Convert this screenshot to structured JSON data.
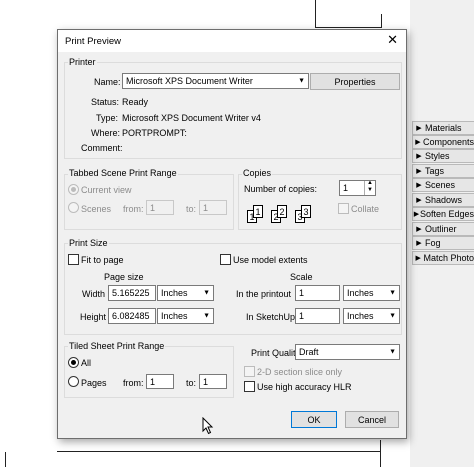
{
  "dialog": {
    "title": "Print Preview",
    "printer": {
      "group_label": "Printer",
      "name_label": "Name:",
      "name_value": "Microsoft XPS Document Writer",
      "properties_label": "Properties",
      "status_label": "Status:",
      "status_value": "Ready",
      "type_label": "Type:",
      "type_value": "Microsoft XPS Document Writer v4",
      "where_label": "Where:",
      "where_value": "PORTPROMPT:",
      "comment_label": "Comment:",
      "comment_value": ""
    },
    "scene_range": {
      "group_label": "Tabbed Scene Print Range",
      "current_view_label": "Current view",
      "scenes_label": "Scenes",
      "from_label": "from:",
      "from_value": "1",
      "to_label": "to:",
      "to_value": "1"
    },
    "copies": {
      "group_label": "Copies",
      "number_label": "Number of copies:",
      "number_value": "1",
      "collate_label": "Collate"
    },
    "print_size": {
      "group_label": "Print Size",
      "fit_to_page_label": "Fit to page",
      "use_model_extents_label": "Use model extents",
      "page_size_label": "Page size",
      "scale_label": "Scale",
      "width_label": "Width",
      "width_value": "5.165225",
      "width_unit": "Inches",
      "height_label": "Height",
      "height_value": "6.082485",
      "height_unit": "Inches",
      "in_printout_label": "In the printout",
      "in_printout_value": "1",
      "in_printout_unit": "Inches",
      "in_sketchup_label": "In SketchUp",
      "in_sketchup_value": "1",
      "in_sketchup_unit": "Inches"
    },
    "sheet_range": {
      "group_label": "Tiled Sheet Print Range",
      "all_label": "All",
      "pages_label": "Pages",
      "from_label": "from:",
      "from_value": "1",
      "to_label": "to:",
      "to_value": "1"
    },
    "quality": {
      "label": "Print Quality",
      "value": "Draft",
      "section_slice_label": "2-D section slice only",
      "high_accuracy_label": "Use high accuracy HLR"
    },
    "ok_label": "OK",
    "cancel_label": "Cancel"
  },
  "tray": [
    {
      "label": "Materials"
    },
    {
      "label": "Components"
    },
    {
      "label": "Styles"
    },
    {
      "label": "Tags"
    },
    {
      "label": "Scenes"
    },
    {
      "label": "Shadows"
    },
    {
      "label": "Soften Edges"
    },
    {
      "label": "Outliner"
    },
    {
      "label": "Fog"
    },
    {
      "label": "Match Photo"
    }
  ],
  "colors": {
    "dialog_bg": "#f0f0f0",
    "default_button_border": "#0078d7",
    "tray_bg": "#e6e6e6"
  }
}
